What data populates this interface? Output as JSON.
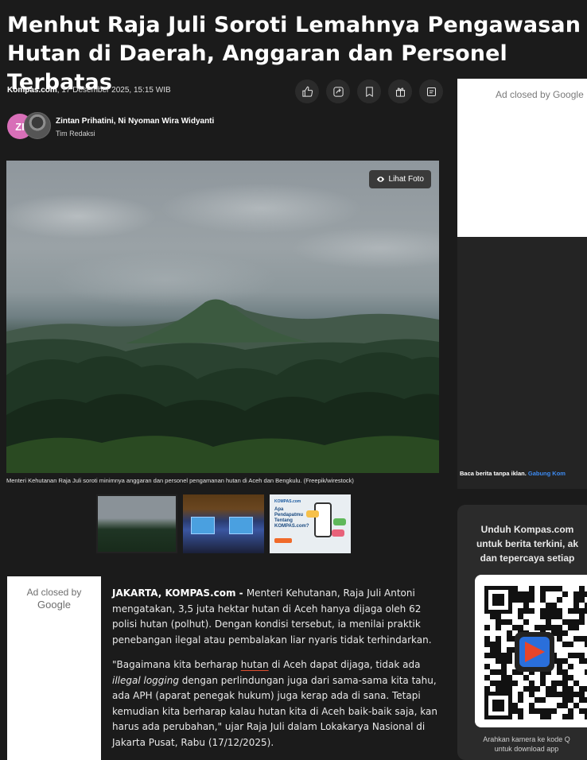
{
  "headline": "Menhut Raja Juli Soroti Lemahnya Pengawasan Hutan di Daerah, Anggaran dan Personel Terbatas",
  "meta": {
    "source": "Kompas.com",
    "datetime": ", 17 Desember 2025, 15:15 WIB"
  },
  "actions": [
    {
      "name": "like-button",
      "icon": "thumbs-up-icon"
    },
    {
      "name": "share-button",
      "icon": "share-icon"
    },
    {
      "name": "bookmark-button",
      "icon": "bookmark-icon"
    },
    {
      "name": "gift-button",
      "icon": "gift-icon"
    },
    {
      "name": "comment-button",
      "icon": "comment-icon"
    }
  ],
  "authors": {
    "initials": "ZI",
    "names": "Zintan Prihatini,  Ni Nyoman Wira Widyanti",
    "team": "Tim Redaksi"
  },
  "photo": {
    "view_label": "Lihat Foto",
    "caption": "Menteri Kehutanan Raja Juli soroti minimnya anggaran dan personel pengamanan hutan di Aceh dan Bengkulu. (Freepik/wirestock)"
  },
  "thumbs": {
    "promo_brand": "KOMPAS.com",
    "promo_title": "Apa Pendapatmu Tentang KOMPAS.com?"
  },
  "ads": {
    "closed_by": "Ad closed by",
    "google": "Google",
    "side": "Ad closed by Google"
  },
  "article": {
    "p1_lead": "JAKARTA, KOMPAS.com - ",
    "p1_text": "Menteri Kehutanan, Raja Juli Antoni mengatakan, 3,5 juta hektar hutan di Aceh hanya dijaga oleh 62 polisi hutan (polhut). Dengan kondisi tersebut, ia menilai praktik penebangan ilegal atau pembalakan liar nyaris tidak terhindarkan.",
    "p2_a": "\"Bagaimana kita berharap ",
    "p2_link": "hutan",
    "p2_b": " di Aceh dapat dijaga, tidak ada ",
    "p2_italic": "illegal logging",
    "p2_c": " dengan perlindungan juga dari sama-sama kita tahu, ada APH (aparat penegak hukum) juga kerap ada di sana. Tetapi kemudian kita berharap kalau hutan kita di Aceh baik-baik saja, kan harus ada perubahan,\" ujar Raja Juli dalam Lokakarya Nasional di Jakarta Pusat, Rabu (17/12/2025)."
  },
  "sidebar": {
    "note": "Baca berita tanpa iklan. ",
    "note_link": "Gabung Kom",
    "promo": "Unduh Kompas.com\nuntuk berita terkini, ak\ndan tepercaya setiap",
    "qr_foot": "Arahkan kamera ke kode Q\nuntuk download app"
  }
}
